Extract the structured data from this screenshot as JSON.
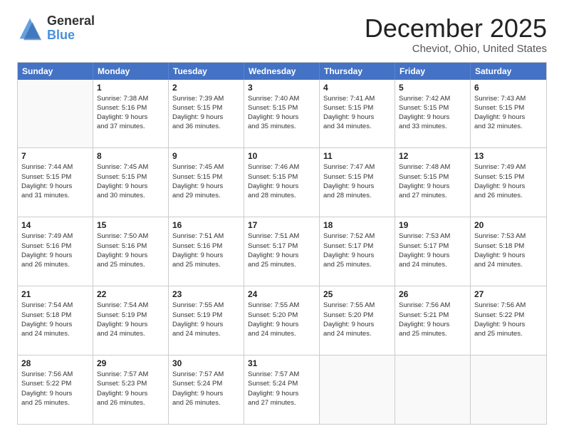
{
  "logo": {
    "general": "General",
    "blue": "Blue"
  },
  "title": "December 2025",
  "subtitle": "Cheviot, Ohio, United States",
  "header_days": [
    "Sunday",
    "Monday",
    "Tuesday",
    "Wednesday",
    "Thursday",
    "Friday",
    "Saturday"
  ],
  "weeks": [
    [
      {
        "day": "",
        "info": ""
      },
      {
        "day": "1",
        "info": "Sunrise: 7:38 AM\nSunset: 5:16 PM\nDaylight: 9 hours\nand 37 minutes."
      },
      {
        "day": "2",
        "info": "Sunrise: 7:39 AM\nSunset: 5:15 PM\nDaylight: 9 hours\nand 36 minutes."
      },
      {
        "day": "3",
        "info": "Sunrise: 7:40 AM\nSunset: 5:15 PM\nDaylight: 9 hours\nand 35 minutes."
      },
      {
        "day": "4",
        "info": "Sunrise: 7:41 AM\nSunset: 5:15 PM\nDaylight: 9 hours\nand 34 minutes."
      },
      {
        "day": "5",
        "info": "Sunrise: 7:42 AM\nSunset: 5:15 PM\nDaylight: 9 hours\nand 33 minutes."
      },
      {
        "day": "6",
        "info": "Sunrise: 7:43 AM\nSunset: 5:15 PM\nDaylight: 9 hours\nand 32 minutes."
      }
    ],
    [
      {
        "day": "7",
        "info": "Sunrise: 7:44 AM\nSunset: 5:15 PM\nDaylight: 9 hours\nand 31 minutes."
      },
      {
        "day": "8",
        "info": "Sunrise: 7:45 AM\nSunset: 5:15 PM\nDaylight: 9 hours\nand 30 minutes."
      },
      {
        "day": "9",
        "info": "Sunrise: 7:45 AM\nSunset: 5:15 PM\nDaylight: 9 hours\nand 29 minutes."
      },
      {
        "day": "10",
        "info": "Sunrise: 7:46 AM\nSunset: 5:15 PM\nDaylight: 9 hours\nand 28 minutes."
      },
      {
        "day": "11",
        "info": "Sunrise: 7:47 AM\nSunset: 5:15 PM\nDaylight: 9 hours\nand 28 minutes."
      },
      {
        "day": "12",
        "info": "Sunrise: 7:48 AM\nSunset: 5:15 PM\nDaylight: 9 hours\nand 27 minutes."
      },
      {
        "day": "13",
        "info": "Sunrise: 7:49 AM\nSunset: 5:15 PM\nDaylight: 9 hours\nand 26 minutes."
      }
    ],
    [
      {
        "day": "14",
        "info": "Sunrise: 7:49 AM\nSunset: 5:16 PM\nDaylight: 9 hours\nand 26 minutes."
      },
      {
        "day": "15",
        "info": "Sunrise: 7:50 AM\nSunset: 5:16 PM\nDaylight: 9 hours\nand 25 minutes."
      },
      {
        "day": "16",
        "info": "Sunrise: 7:51 AM\nSunset: 5:16 PM\nDaylight: 9 hours\nand 25 minutes."
      },
      {
        "day": "17",
        "info": "Sunrise: 7:51 AM\nSunset: 5:17 PM\nDaylight: 9 hours\nand 25 minutes."
      },
      {
        "day": "18",
        "info": "Sunrise: 7:52 AM\nSunset: 5:17 PM\nDaylight: 9 hours\nand 25 minutes."
      },
      {
        "day": "19",
        "info": "Sunrise: 7:53 AM\nSunset: 5:17 PM\nDaylight: 9 hours\nand 24 minutes."
      },
      {
        "day": "20",
        "info": "Sunrise: 7:53 AM\nSunset: 5:18 PM\nDaylight: 9 hours\nand 24 minutes."
      }
    ],
    [
      {
        "day": "21",
        "info": "Sunrise: 7:54 AM\nSunset: 5:18 PM\nDaylight: 9 hours\nand 24 minutes."
      },
      {
        "day": "22",
        "info": "Sunrise: 7:54 AM\nSunset: 5:19 PM\nDaylight: 9 hours\nand 24 minutes."
      },
      {
        "day": "23",
        "info": "Sunrise: 7:55 AM\nSunset: 5:19 PM\nDaylight: 9 hours\nand 24 minutes."
      },
      {
        "day": "24",
        "info": "Sunrise: 7:55 AM\nSunset: 5:20 PM\nDaylight: 9 hours\nand 24 minutes."
      },
      {
        "day": "25",
        "info": "Sunrise: 7:55 AM\nSunset: 5:20 PM\nDaylight: 9 hours\nand 24 minutes."
      },
      {
        "day": "26",
        "info": "Sunrise: 7:56 AM\nSunset: 5:21 PM\nDaylight: 9 hours\nand 25 minutes."
      },
      {
        "day": "27",
        "info": "Sunrise: 7:56 AM\nSunset: 5:22 PM\nDaylight: 9 hours\nand 25 minutes."
      }
    ],
    [
      {
        "day": "28",
        "info": "Sunrise: 7:56 AM\nSunset: 5:22 PM\nDaylight: 9 hours\nand 25 minutes."
      },
      {
        "day": "29",
        "info": "Sunrise: 7:57 AM\nSunset: 5:23 PM\nDaylight: 9 hours\nand 26 minutes."
      },
      {
        "day": "30",
        "info": "Sunrise: 7:57 AM\nSunset: 5:24 PM\nDaylight: 9 hours\nand 26 minutes."
      },
      {
        "day": "31",
        "info": "Sunrise: 7:57 AM\nSunset: 5:24 PM\nDaylight: 9 hours\nand 27 minutes."
      },
      {
        "day": "",
        "info": ""
      },
      {
        "day": "",
        "info": ""
      },
      {
        "day": "",
        "info": ""
      }
    ]
  ]
}
